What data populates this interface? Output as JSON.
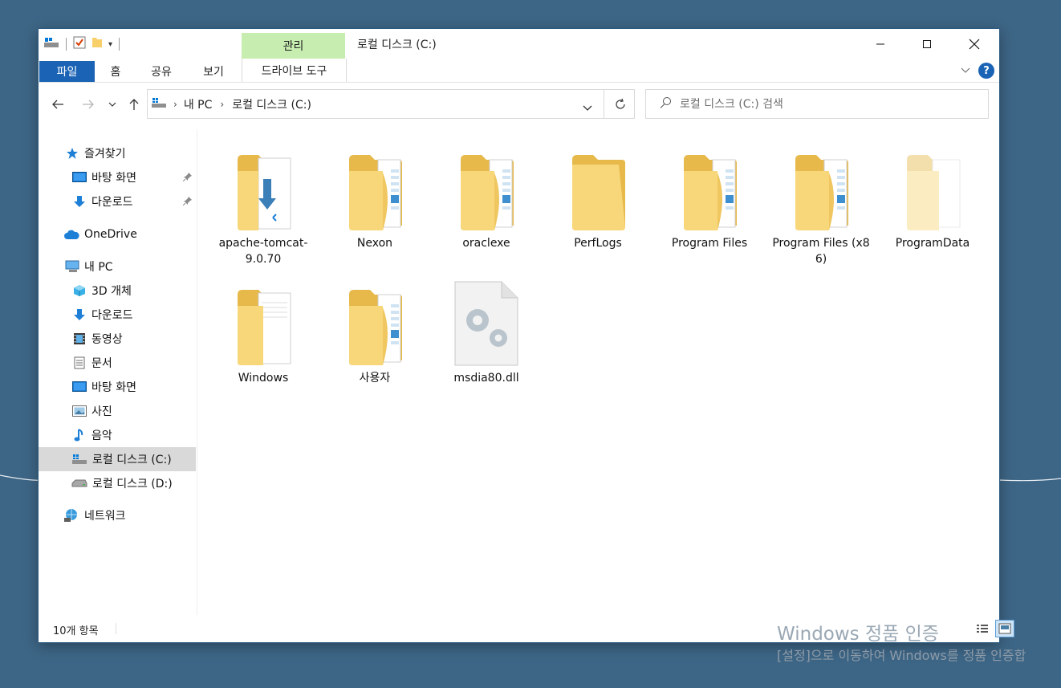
{
  "window": {
    "title": "로컬 디스크 (C:)",
    "context_tab": "관리",
    "context_tool": "드라이브 도구"
  },
  "ribbon": {
    "tabs": [
      "파일",
      "홈",
      "공유",
      "보기"
    ]
  },
  "address": {
    "crumbs": [
      "내 PC",
      "로컬 디스크 (C:)"
    ]
  },
  "search": {
    "placeholder": "로컬 디스크 (C:) 검색"
  },
  "sidebar": {
    "items": [
      {
        "label": "즐겨찾기",
        "icon": "star-icon"
      },
      {
        "label": "바탕 화면",
        "icon": "desktop-icon",
        "pinned": true
      },
      {
        "label": "다운로드",
        "icon": "download-icon",
        "pinned": true
      },
      {
        "label": "OneDrive",
        "icon": "cloud-icon"
      },
      {
        "label": "내 PC",
        "icon": "computer-icon"
      },
      {
        "label": "3D 개체",
        "icon": "cube-icon"
      },
      {
        "label": "다운로드",
        "icon": "download-icon"
      },
      {
        "label": "동영상",
        "icon": "film-icon"
      },
      {
        "label": "문서",
        "icon": "document-icon"
      },
      {
        "label": "바탕 화면",
        "icon": "desktop-icon"
      },
      {
        "label": "사진",
        "icon": "picture-icon"
      },
      {
        "label": "음악",
        "icon": "music-icon"
      },
      {
        "label": "로컬 디스크 (C:)",
        "icon": "drive-windows-icon",
        "selected": true
      },
      {
        "label": "로컬 디스크 (D:)",
        "icon": "drive-icon"
      },
      {
        "label": "네트워크",
        "icon": "network-icon"
      }
    ]
  },
  "files": [
    {
      "name": "apache-tomcat-9.0.70",
      "type": "folder-vscode"
    },
    {
      "name": "Nexon",
      "type": "folder"
    },
    {
      "name": "oraclexe",
      "type": "folder"
    },
    {
      "name": "PerfLogs",
      "type": "folder-empty"
    },
    {
      "name": "Program Files",
      "type": "folder"
    },
    {
      "name": "Program Files (x86)",
      "type": "folder"
    },
    {
      "name": "ProgramData",
      "type": "folder-hidden"
    },
    {
      "name": "Windows",
      "type": "folder-docs"
    },
    {
      "name": "사용자",
      "type": "folder"
    },
    {
      "name": "msdia80.dll",
      "type": "dll"
    }
  ],
  "status": {
    "item_count": "10개 항목"
  },
  "watermark": {
    "line1": "Windows 정품 인증",
    "line2": "[설정]으로 이동하여 Windows를 정품 인증합"
  }
}
